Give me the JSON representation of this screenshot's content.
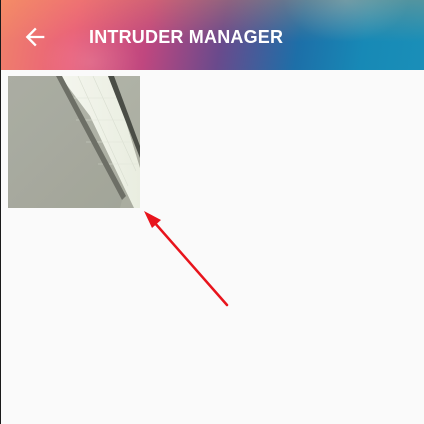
{
  "toolbar": {
    "title": "INTRUDER MANAGER",
    "back_icon": "arrow-back-icon"
  },
  "gallery": {
    "items": [
      {
        "kind": "intruder-photo"
      }
    ]
  },
  "annotation": {
    "type": "red-arrow",
    "color": "#e8141c"
  }
}
